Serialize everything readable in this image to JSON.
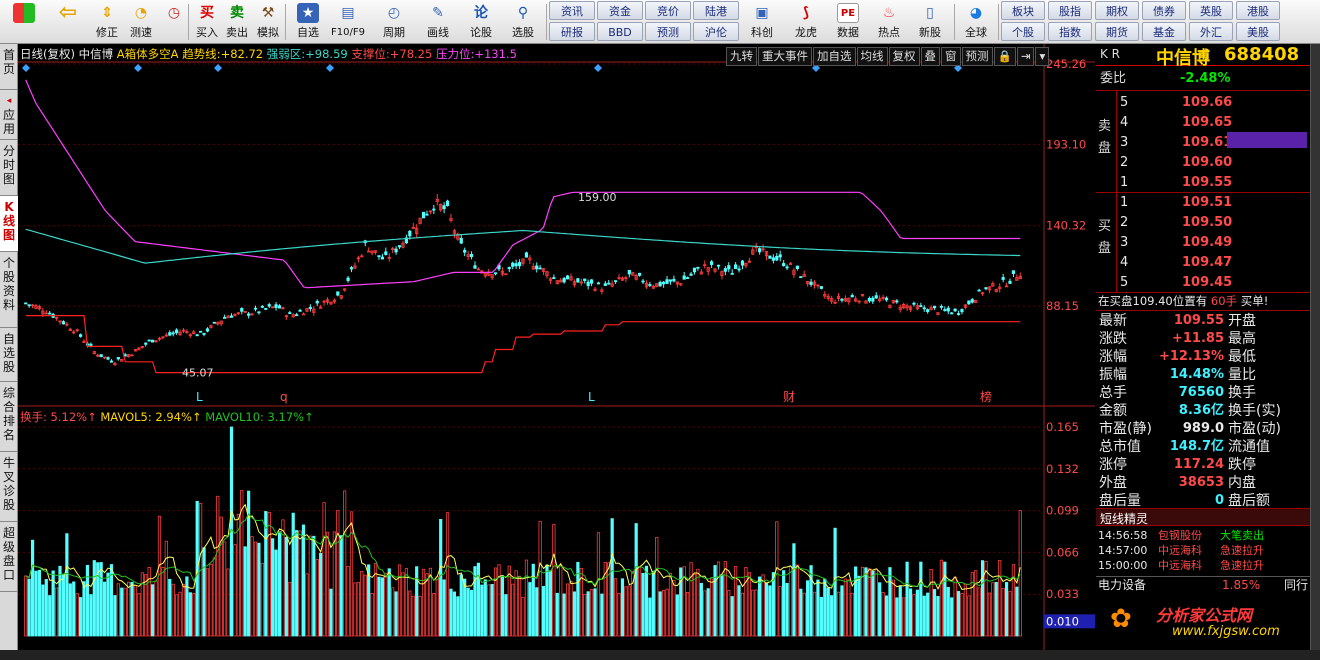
{
  "toolbar": {
    "buttons": [
      {
        "label": "",
        "icon": "windows-icon"
      },
      {
        "label": "",
        "icon": "back-arrow-icon"
      },
      {
        "label": "修正",
        "icon": "refresh-icon"
      },
      {
        "label": "测速",
        "icon": "clock-icon"
      },
      {
        "label": "买入",
        "icon": "buy-icon",
        "glyph": "买"
      },
      {
        "label": "卖出",
        "icon": "sell-icon",
        "glyph": "卖"
      },
      {
        "label": "模拟",
        "icon": "gavel-icon"
      },
      {
        "label": "自选",
        "icon": "star-icon"
      },
      {
        "label": "F10/F9",
        "icon": "f10-icon"
      },
      {
        "label": "周期",
        "icon": "period-icon"
      },
      {
        "label": "画线",
        "icon": "pen-icon"
      },
      {
        "label": "论股",
        "icon": "discuss-icon",
        "glyph": "论"
      },
      {
        "label": "选股",
        "icon": "select-stock-icon"
      },
      {
        "label": "科创",
        "icon": "science-icon"
      },
      {
        "label": "龙虎",
        "icon": "dragon-icon"
      },
      {
        "label": "数据",
        "icon": "pe-icon",
        "glyph": "PE"
      },
      {
        "label": "热点",
        "icon": "hot-icon"
      },
      {
        "label": "新股",
        "icon": "new-stock-icon"
      },
      {
        "label": "全球",
        "icon": "globe-icon"
      }
    ],
    "grid_left": [
      "资讯",
      "资金",
      "竞价",
      "陆港",
      "研报",
      "BBD",
      "预测",
      "沪伦"
    ],
    "grid_right": [
      "板块",
      "股指",
      "期权",
      "债券",
      "英股",
      "港股",
      "个股",
      "指数",
      "期货",
      "基金",
      "外汇",
      "美股"
    ]
  },
  "leftnav": [
    "首页",
    "应用",
    "分时图",
    "K线图",
    "个股资料",
    "自选股",
    "综合排名",
    "牛叉诊股",
    "超级盘口"
  ],
  "chart": {
    "legend": {
      "period": "日线(复权)",
      "name": "中信博",
      "indicator": "A箱体多空A",
      "trend_label": "趋势线:",
      "trend_val": "+82.72",
      "qr_label": "强弱区:",
      "qr_val": "+98.59",
      "support_label": "支撑位:",
      "support_val": "+78.25",
      "press_label": "压力位:",
      "press_val": "+131.5"
    },
    "tabs": [
      "九转",
      "重大事件",
      "加自选",
      "均线",
      "复权",
      "叠",
      "窗",
      "预测"
    ],
    "price_ticks": [
      "245.26",
      "193.10",
      "140.32",
      "88.15"
    ],
    "high_label": "159.00",
    "low_label": "45.07",
    "markers": [
      "L",
      "q",
      "L",
      "财",
      "榜"
    ],
    "vol_legend": {
      "hs_label": "换手: 5.12%↑",
      "ma5_label": "MAVOL5: 2.94%↑",
      "ma10_label": "MAVOL10: 3.17%↑"
    },
    "vol_ticks": [
      "0.165",
      "0.132",
      "0.099",
      "0.066",
      "0.033"
    ],
    "vol_current": "0.010",
    "colors": {
      "up": "#ff3c3c",
      "down": "#54ffff",
      "support": "#ff2020",
      "pressure": "#ff40ff",
      "strong": "#3cd6c8",
      "ma5": "#ffff60",
      "ma10": "#20c020"
    }
  },
  "panel": {
    "code_label": "K R",
    "stock_name": "中信博",
    "stock_code": "688408",
    "weibi_label": "委比",
    "weibi": "-2.48%",
    "sell_label": "卖盘",
    "buy_label": "买盘",
    "sells": [
      {
        "lvl": "5",
        "price": "109.66"
      },
      {
        "lvl": "4",
        "price": "109.65"
      },
      {
        "lvl": "3",
        "price": "109.61"
      },
      {
        "lvl": "2",
        "price": "109.60"
      },
      {
        "lvl": "1",
        "price": "109.55"
      }
    ],
    "buys": [
      {
        "lvl": "1",
        "price": "109.51"
      },
      {
        "lvl": "2",
        "price": "109.50"
      },
      {
        "lvl": "3",
        "price": "109.49"
      },
      {
        "lvl": "4",
        "price": "109.47"
      },
      {
        "lvl": "5",
        "price": "109.45"
      }
    ],
    "ticker": "在买盘109.40位置有",
    "ticker_qty": "60手",
    "ticker_tag": "买单!",
    "quotes": [
      {
        "k": "最新",
        "v": "109.55",
        "c": "red",
        "k2": "开盘"
      },
      {
        "k": "涨跌",
        "v": "+11.85",
        "c": "red",
        "k2": "最高"
      },
      {
        "k": "涨幅",
        "v": "+12.13%",
        "c": "red",
        "k2": "最低"
      },
      {
        "k": "振幅",
        "v": "14.48%",
        "c": "cyan",
        "k2": "量比"
      },
      {
        "k": "总手",
        "v": "76560",
        "c": "cyan",
        "k2": "换手"
      },
      {
        "k": "金额",
        "v": "8.36亿",
        "c": "cyan",
        "k2": "换手(实)"
      },
      {
        "k": "市盈(静)",
        "v": "989.0",
        "c": "wht",
        "k2": "市盈(动)"
      },
      {
        "k": "总市值",
        "v": "148.7亿",
        "c": "cyan",
        "k2": "流通值"
      },
      {
        "k": "涨停",
        "v": "117.24",
        "c": "red",
        "k2": "跌停"
      },
      {
        "k": "外盘",
        "v": "38653",
        "c": "red",
        "k2": "内盘"
      },
      {
        "k": "盘后量",
        "v": "0",
        "c": "cyan",
        "k2": "盘后额"
      }
    ],
    "spirit_title": "短线精灵",
    "spirit": [
      {
        "time": "14:56:58",
        "name": "包钢股份",
        "event": "大笔卖出",
        "ec": "grn"
      },
      {
        "time": "14:57:00",
        "name": "中远海科",
        "event": "急速拉升",
        "ec": "red"
      },
      {
        "time": "15:00:00",
        "name": "中远海科",
        "event": "急速拉升",
        "ec": "red"
      }
    ],
    "sector_name": "电力设备",
    "sector_pct": "1.85%",
    "sector_tag": "同行"
  },
  "watermark": {
    "name": "分析家公式网",
    "url": "www.fxjgsw.com"
  }
}
